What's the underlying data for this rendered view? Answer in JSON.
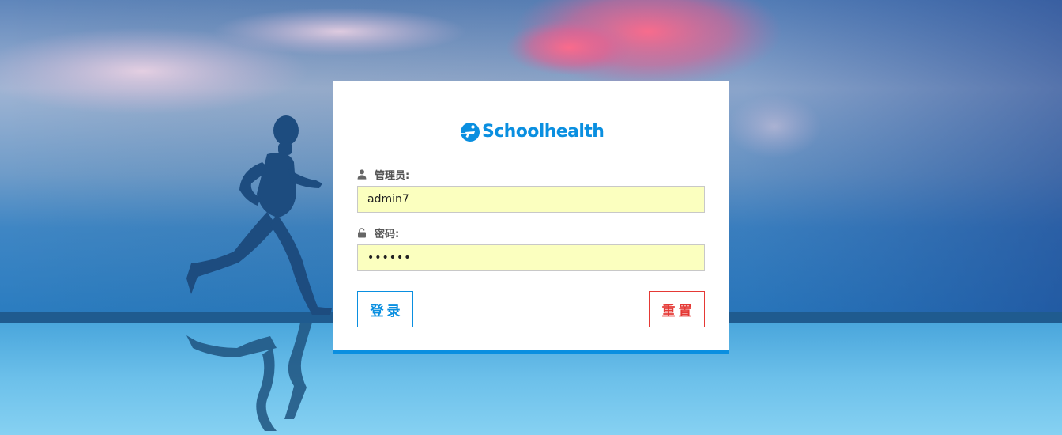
{
  "brand": {
    "logo_text": "Schoolhealth",
    "logo_icon": "running-person-circle-icon",
    "accent_color": "#0a8fe0"
  },
  "form": {
    "username": {
      "label": "管理员:",
      "icon": "user-icon",
      "value": "admin7"
    },
    "password": {
      "label": "密码:",
      "icon": "unlock-icon",
      "value": "123456"
    }
  },
  "buttons": {
    "login_label": "登录",
    "login_color": "#0a8fe0",
    "reset_label": "重置",
    "reset_color": "#e53935"
  },
  "background": {
    "scene": "runner-silhouette-at-seaside",
    "input_fill_color": "#fbffbf"
  }
}
